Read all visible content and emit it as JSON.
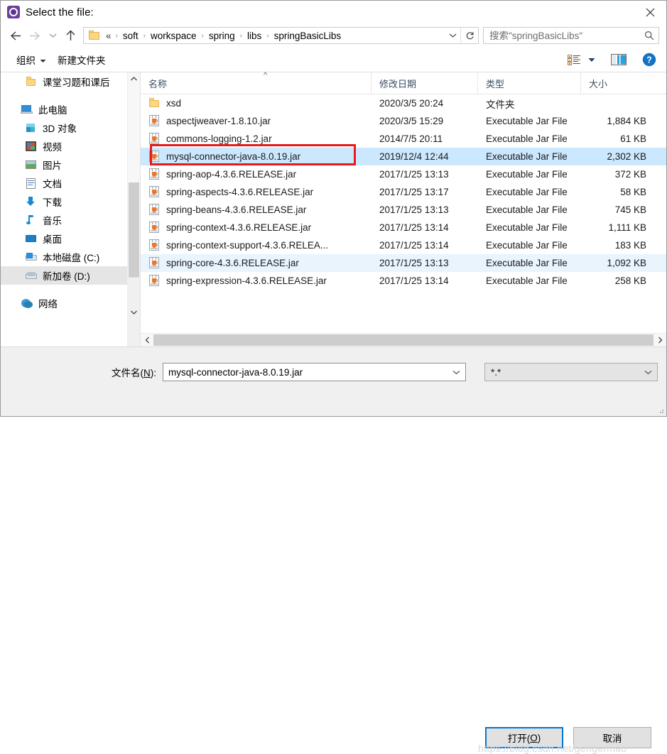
{
  "window": {
    "title": "Select the file:",
    "icon": "app-gear-icon",
    "close_label": "×"
  },
  "navbar": {
    "back_title": "←",
    "forward_title": "→",
    "recent_title": "⌄",
    "up_title": "↑",
    "breadcrumb_lead": "«",
    "breadcrumbs": [
      "soft",
      "workspace",
      "spring",
      "libs",
      "springBasicLibs"
    ],
    "separator": "›",
    "refresh_icon": "refresh-icon",
    "search": {
      "placeholder": "搜索\"springBasicLibs\"",
      "value": ""
    }
  },
  "commandbar": {
    "organize_label": "组织",
    "new_folder_label": "新建文件夹",
    "view_icon": "view-list-icon",
    "pane_icon": "preview-pane-icon",
    "help_icon": "help-icon"
  },
  "sidebar": {
    "items": [
      {
        "label": "课堂习题和课后",
        "icon": "folder-icon",
        "selected": false,
        "indent": 2,
        "gap_after": true
      },
      {
        "label": "此电脑",
        "icon": "this-pc-icon",
        "selected": false,
        "indent": 1
      },
      {
        "label": "3D 对象",
        "icon": "3d-objects-icon",
        "selected": false,
        "indent": 2
      },
      {
        "label": "视频",
        "icon": "videos-icon",
        "selected": false,
        "indent": 2
      },
      {
        "label": "图片",
        "icon": "pictures-icon",
        "selected": false,
        "indent": 2
      },
      {
        "label": "文档",
        "icon": "documents-icon",
        "selected": false,
        "indent": 2
      },
      {
        "label": "下载",
        "icon": "downloads-icon",
        "selected": false,
        "indent": 2
      },
      {
        "label": "音乐",
        "icon": "music-icon",
        "selected": false,
        "indent": 2
      },
      {
        "label": "桌面",
        "icon": "desktop-icon",
        "selected": false,
        "indent": 2
      },
      {
        "label": "本地磁盘 (C:)",
        "icon": "local-disk-icon",
        "selected": false,
        "indent": 2
      },
      {
        "label": "新加卷 (D:)",
        "icon": "drive-icon",
        "selected": true,
        "indent": 2,
        "gap_after": true
      },
      {
        "label": "网络",
        "icon": "network-icon",
        "selected": false,
        "indent": 1
      }
    ]
  },
  "filelist": {
    "columns": [
      {
        "key": "name",
        "label": "名称"
      },
      {
        "key": "date",
        "label": "修改日期"
      },
      {
        "key": "type",
        "label": "类型"
      },
      {
        "key": "size",
        "label": "大小"
      }
    ],
    "rows": [
      {
        "name": "xsd",
        "date": "2020/3/5 20:24",
        "type": "文件夹",
        "size": "",
        "icon": "folder-icon",
        "state": "normal"
      },
      {
        "name": "aspectjweaver-1.8.10.jar",
        "date": "2020/3/5 15:29",
        "type": "Executable Jar File",
        "size": "1,884 KB",
        "icon": "jar-icon",
        "state": "normal"
      },
      {
        "name": "commons-logging-1.2.jar",
        "date": "2014/7/5 20:11",
        "type": "Executable Jar File",
        "size": "61 KB",
        "icon": "jar-icon",
        "state": "normal"
      },
      {
        "name": "mysql-connector-java-8.0.19.jar",
        "date": "2019/12/4 12:44",
        "type": "Executable Jar File",
        "size": "2,302 KB",
        "icon": "jar-icon",
        "state": "selected"
      },
      {
        "name": "spring-aop-4.3.6.RELEASE.jar",
        "date": "2017/1/25 13:13",
        "type": "Executable Jar File",
        "size": "372 KB",
        "icon": "jar-icon",
        "state": "normal"
      },
      {
        "name": "spring-aspects-4.3.6.RELEASE.jar",
        "date": "2017/1/25 13:17",
        "type": "Executable Jar File",
        "size": "58 KB",
        "icon": "jar-icon",
        "state": "normal"
      },
      {
        "name": "spring-beans-4.3.6.RELEASE.jar",
        "date": "2017/1/25 13:13",
        "type": "Executable Jar File",
        "size": "745 KB",
        "icon": "jar-icon",
        "state": "normal"
      },
      {
        "name": "spring-context-4.3.6.RELEASE.jar",
        "date": "2017/1/25 13:14",
        "type": "Executable Jar File",
        "size": "1,111 KB",
        "icon": "jar-icon",
        "state": "normal"
      },
      {
        "name": "spring-context-support-4.3.6.RELEA...",
        "date": "2017/1/25 13:14",
        "type": "Executable Jar File",
        "size": "183 KB",
        "icon": "jar-icon",
        "state": "normal"
      },
      {
        "name": "spring-core-4.3.6.RELEASE.jar",
        "date": "2017/1/25 13:13",
        "type": "Executable Jar File",
        "size": "1,092 KB",
        "icon": "jar-icon",
        "state": "hover"
      },
      {
        "name": "spring-expression-4.3.6.RELEASE.jar",
        "date": "2017/1/25 13:14",
        "type": "Executable Jar File",
        "size": "258 KB",
        "icon": "jar-icon",
        "state": "normal"
      }
    ]
  },
  "annotation": {
    "color": "#e81a1a",
    "target_row_index": 3
  },
  "bottom": {
    "filename_label_prefix": "文件名(",
    "filename_label_accel": "N",
    "filename_label_suffix": "):",
    "filename_value": "mysql-connector-java-8.0.19.jar",
    "filter_value": "*.*",
    "open_prefix": "打开(",
    "open_accel": "O",
    "open_suffix": ")",
    "cancel_label": "取消"
  },
  "watermark": {
    "text": "https://blog.csdn.net/gengermao"
  },
  "colors": {
    "selection": "#cce8ff",
    "hover": "#e9f4fd",
    "focus_border": "#0078d7",
    "annotation": "#e81a1a",
    "header_text": "#3b4d63"
  }
}
